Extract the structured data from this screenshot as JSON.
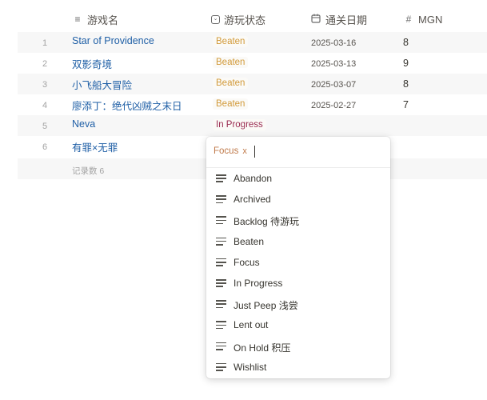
{
  "columns": {
    "name": "游戏名",
    "status": "游玩状态",
    "date": "通关日期",
    "mgn": "MGN"
  },
  "rows": [
    {
      "num": "1",
      "name": "Star of Providence",
      "status": "Beaten",
      "date": "2025-03-16",
      "mgn": "8"
    },
    {
      "num": "2",
      "name": "双影奇境",
      "status": "Beaten",
      "date": "2025-03-13",
      "mgn": "9"
    },
    {
      "num": "3",
      "name": "小飞船大冒险",
      "status": "Beaten",
      "date": "2025-03-07",
      "mgn": "8"
    },
    {
      "num": "4",
      "name": "廖添丁：绝代凶贼之末日",
      "status": "Beaten",
      "date": "2025-02-27",
      "mgn": "7"
    },
    {
      "num": "5",
      "name": "Neva",
      "status": "In Progress",
      "date": "",
      "mgn": ""
    },
    {
      "num": "6",
      "name": "有罪×无罪",
      "status": "",
      "date": "",
      "mgn": ""
    }
  ],
  "footer": {
    "record_count": "记录数 6"
  },
  "colors": {
    "beaten": "#d29a3a",
    "in_progress": "#9b2d52",
    "link": "#1f5fa6"
  },
  "icons": {
    "name_column": "text-lines-icon",
    "status_column": "checkbox-chevron-icon",
    "date_column": "calendar-icon",
    "mgn_column": "hash-icon",
    "option": "text-lines-icon"
  },
  "dropdown": {
    "selected_tag": "Focus",
    "remove_glyph": "x",
    "options": [
      "Abandon",
      "Archived",
      "Backlog 待游玩",
      "Beaten",
      "Focus",
      "In Progress",
      "Just Peep 浅尝",
      "Lent out",
      "On Hold 积压",
      "Wishlist"
    ]
  }
}
